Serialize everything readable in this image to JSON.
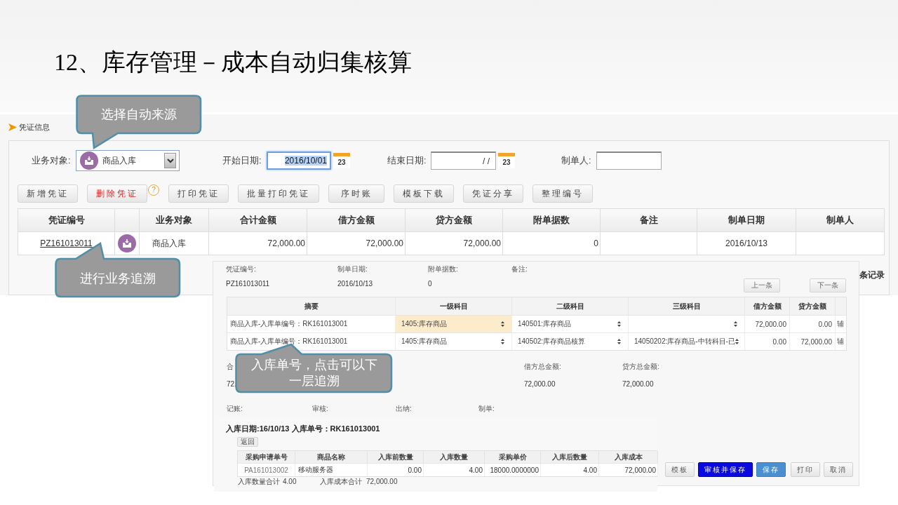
{
  "slide_title": "12、库存管理－成本自动归集核算",
  "voucher_list": {
    "section_title": "凭证信息",
    "filters": {
      "business_label": "业务对象:",
      "business_value": "商品入库",
      "start_label": "开始日期:",
      "start_value": "2016/10/01",
      "start_calendar_day": "23",
      "end_label": "结束日期:",
      "end_value": "/ /",
      "end_calendar_day": "23",
      "maker_label": "制单人:"
    },
    "toolbar": [
      {
        "label": "新增凭证",
        "kind": "normal"
      },
      {
        "label": "删除凭证",
        "kind": "danger"
      },
      {
        "label": "?",
        "kind": "help"
      },
      {
        "label": "打印凭证",
        "kind": "normal"
      },
      {
        "label": "批量打印凭证",
        "kind": "normal"
      },
      {
        "label": "序时账",
        "kind": "normal"
      },
      {
        "label": "模板下载",
        "kind": "normal"
      },
      {
        "label": "凭证分享",
        "kind": "normal"
      },
      {
        "label": "整理编号",
        "kind": "normal"
      }
    ],
    "columns": [
      "凭证编号",
      "业务对象",
      "合计金额",
      "借方金额",
      "贷方金额",
      "附单据数",
      "备注",
      "制单日期",
      "制单人"
    ],
    "rows": [
      {
        "voucher_no": "PZ161013011",
        "business": "商品入库",
        "total": "72,000.00",
        "debit": "72,000.00",
        "credit": "72,000.00",
        "attachments": "0",
        "date": "2016/10/13"
      }
    ],
    "records_text": "条记录"
  },
  "voucher_detail": {
    "fields": [
      {
        "label": "凭证编号:",
        "value": "PZ161013011"
      },
      {
        "label": "制单日期:",
        "value": "2016/10/13"
      },
      {
        "label": "附单据数:",
        "value": "0"
      },
      {
        "label": "备注:"
      }
    ],
    "nav_buttons": [
      "上一条",
      "下一条"
    ],
    "columns": [
      "摘要",
      "一级科目",
      "二级科目",
      "三级科目",
      "借方金额",
      "贷方金额"
    ],
    "entries": [
      {
        "summary": "商品入库-入库单编号：RK161013001",
        "level1": "1405:库存商品",
        "level1_focused": true,
        "level2": "140501:库存商品",
        "debit": "72,000.00",
        "credit": "0.00",
        "aux": "辅"
      },
      {
        "summary": "商品入库-入库单编号：RK161013001",
        "level1": "1405:库存商品",
        "level1_focused": false,
        "level2": "140502:库存商品核算",
        "level3": "14050202:库存商品-中转科目-已",
        "debit": "0.00",
        "credit": "72,000.00",
        "aux": "辅"
      }
    ],
    "totals": [
      {
        "label": "合",
        "value": "72."
      },
      {
        "label": "借方总金额:",
        "value": "72,000.00"
      },
      {
        "label": "贷方总金额:",
        "value": "72,000.00"
      }
    ],
    "signoffs": [
      "记账:",
      "审核:",
      "出纳:",
      "制单:"
    ],
    "actions": [
      {
        "label": "模板",
        "kind": "normal"
      },
      {
        "label": "审核并保存",
        "kind": "primary"
      },
      {
        "label": "保存",
        "kind": "secondary"
      },
      {
        "label": "打印",
        "kind": "normal"
      },
      {
        "label": "取消",
        "kind": "normal"
      }
    ]
  },
  "inbound_doc": {
    "title": "入库日期:16/10/13 入库单号：RK161013001",
    "back_button": "返回",
    "columns": [
      "采购申请单号",
      "商品名称",
      "入库前数量",
      "入库数量",
      "采购单价",
      "入库后数量",
      "入库成本"
    ],
    "rows": [
      {
        "cells": [
          "PA161013002",
          "移动服务器",
          "0.00",
          "4.00",
          "18000.0000000",
          "4.00",
          "72,000.00"
        ]
      }
    ],
    "totals": [
      {
        "label": "入库数量合计",
        "value": "4.00"
      },
      {
        "label": "入库成本合计",
        "value": "72,000.00"
      }
    ]
  },
  "callouts": [
    {
      "text": "选择自动来源"
    },
    {
      "text": "进行业务追溯"
    },
    {
      "text": "入库单号，点击可以下一层追溯"
    }
  ]
}
